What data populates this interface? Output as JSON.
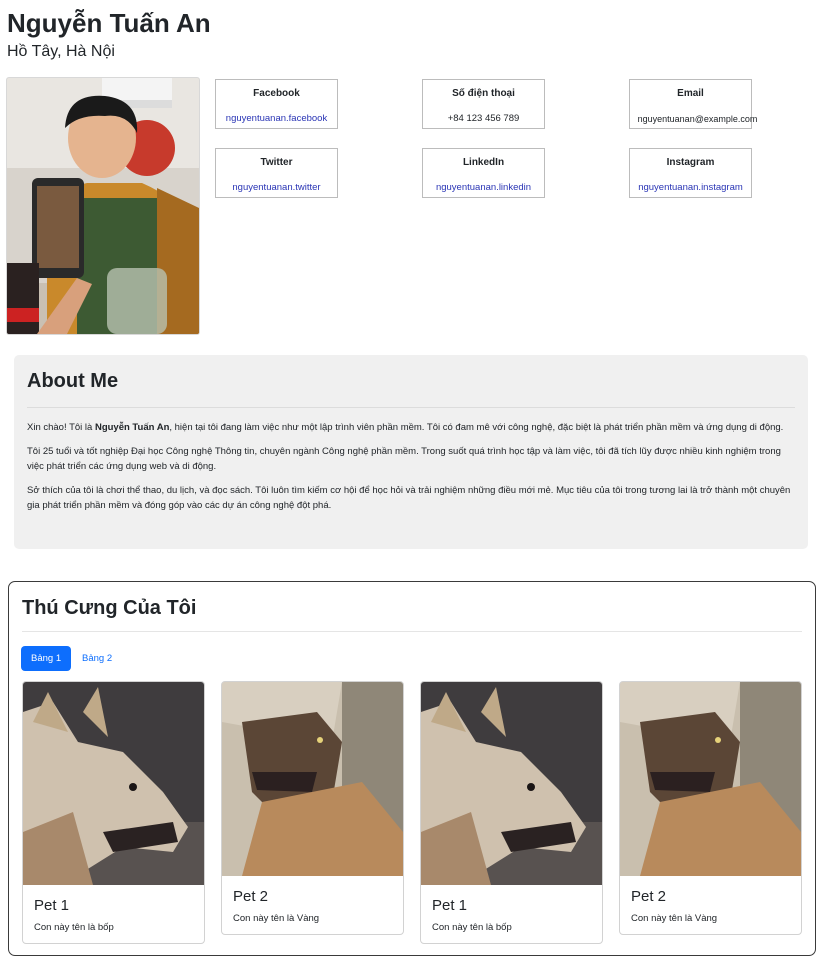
{
  "profile": {
    "name": "Nguyễn Tuấn An",
    "location": "Hồ Tây, Hà Nội"
  },
  "contacts": [
    {
      "title": "Facebook",
      "value": "nguyentuanan.facebook",
      "link": true
    },
    {
      "title": "Số điện thoại",
      "value": "+84 123 456 789",
      "link": false
    },
    {
      "title": "Email",
      "value": "nguyentuanan@example.com",
      "link": false
    },
    {
      "title": "Twitter",
      "value": "nguyentuanan.twitter",
      "link": true
    },
    {
      "title": "LinkedIn",
      "value": "nguyentuanan.linkedin",
      "link": true
    },
    {
      "title": "Instagram",
      "value": "nguyentuanan.instagram",
      "link": true
    }
  ],
  "about": {
    "title": "About Me",
    "p1_before": "Xin chào! Tôi là ",
    "p1_bold": "Nguyễn Tuấn An",
    "p1_after": ", hiện tại tôi đang làm việc như một lập trình viên phần mềm. Tôi có đam mê với công nghệ, đặc biệt là phát triển phần mềm và ứng dụng di động.",
    "p2": "Tôi 25 tuổi và tốt nghiệp Đại học Công nghệ Thông tin, chuyên ngành Công nghệ phần mềm. Trong suốt quá trình học tập và làm việc, tôi đã tích lũy được nhiều kinh nghiệm trong việc phát triển các ứng dụng web và di động.",
    "p3": "Sở thích của tôi là chơi thể thao, du lịch, và đọc sách. Tôi luôn tìm kiếm cơ hội để học hỏi và trải nghiệm những điều mới mẻ. Mục tiêu của tôi trong tương lai là trở thành một chuyên gia phát triển phần mềm và đóng góp vào các dự án công nghệ đột phá."
  },
  "pets": {
    "title": "Thú Cưng Của Tôi",
    "tabs": [
      "Bảng 1",
      "Bảng 2"
    ],
    "cards": [
      {
        "name": "Pet 1",
        "desc": "Con này tên là bốp"
      },
      {
        "name": "Pet 2",
        "desc": "Con này tên là Vàng"
      },
      {
        "name": "Pet 1",
        "desc": "Con này tên là bốp"
      },
      {
        "name": "Pet 2",
        "desc": "Con này tên là Vàng"
      }
    ]
  },
  "colors": {
    "accent": "#0d6efd",
    "link": "#2a35b5",
    "about_bg": "#f0f0f0"
  }
}
